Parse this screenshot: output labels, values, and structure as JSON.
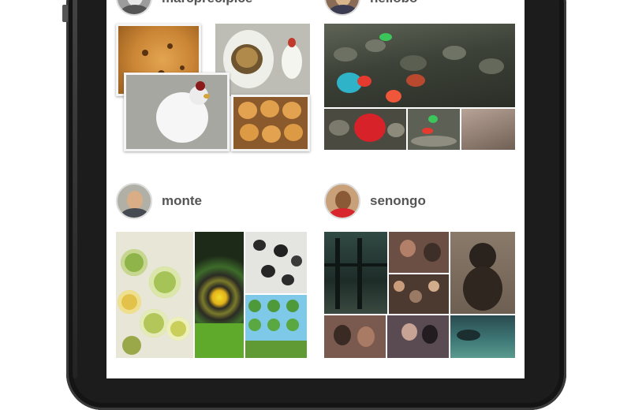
{
  "users": [
    {
      "name": "marcprecipice",
      "photos": [
        "cookie",
        "egg-sculpture",
        "hen-figurine",
        "cookies-tray",
        "chicken-figurine"
      ]
    },
    {
      "name": "hellobo",
      "photos": [
        "beach-stones",
        "red-stone",
        "stones-green",
        "sand"
      ]
    },
    {
      "name": "monte",
      "photos": [
        "glass-circles",
        "spiral-tunnel",
        "dark-spots",
        "trees-pattern"
      ]
    },
    {
      "name": "senongo",
      "photos": [
        "window-view",
        "people-room",
        "silhouette",
        "cafe-interior",
        "friends",
        "water-scene"
      ]
    }
  ]
}
